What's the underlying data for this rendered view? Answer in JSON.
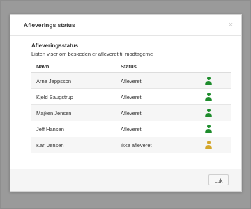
{
  "modal": {
    "title": "Afleverings status",
    "close_symbol": "×",
    "section_title": "Afleveringsstatus",
    "section_desc": "Listen viser om beskeden er afleveret til modtagerne",
    "columns": [
      "Navn",
      "Status"
    ],
    "rows": [
      {
        "name": "Arne Jeppsson",
        "status": "Afleveret",
        "icon": "user-icon",
        "icon_color": "#1e8c2c"
      },
      {
        "name": "Kjeld Saugstrup",
        "status": "Afleveret",
        "icon": "user-icon",
        "icon_color": "#1e8c2c"
      },
      {
        "name": "Majken Jensen",
        "status": "Afleveret",
        "icon": "user-icon",
        "icon_color": "#1e8c2c"
      },
      {
        "name": "Jeff Hansen",
        "status": "Afleveret",
        "icon": "user-icon",
        "icon_color": "#1e8c2c"
      },
      {
        "name": "Karl Jensen",
        "status": "Ikke afleveret",
        "icon": "user-icon",
        "icon_color": "#d4a72c"
      }
    ],
    "footer_button": "Luk"
  }
}
